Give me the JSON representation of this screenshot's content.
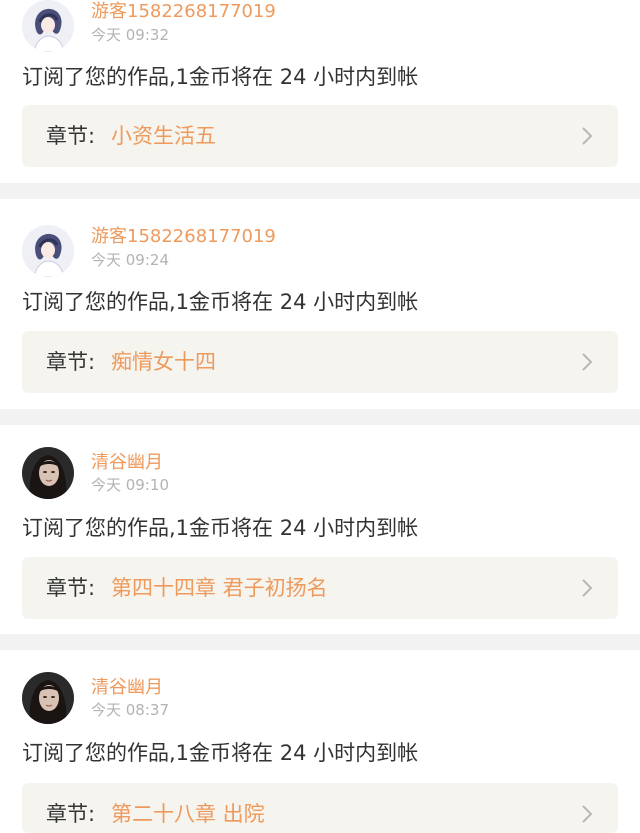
{
  "feed": {
    "items": [
      {
        "avatar_icon": "girl-illustration-avatar-icon",
        "username": "游客1582268177019",
        "time": "今天 09:32",
        "message": "订阅了您的作品,1金币将在 24 小时内到帐",
        "chapter_label": "章节:",
        "chapter_title": "小资生活五"
      },
      {
        "avatar_icon": "girl-illustration-avatar-icon",
        "username": "游客1582268177019",
        "time": "今天 09:24",
        "message": "订阅了您的作品,1金币将在 24 小时内到帐",
        "chapter_label": "章节:",
        "chapter_title": "痴情女十四"
      },
      {
        "avatar_icon": "woman-photo-avatar-icon",
        "username": "清谷幽月",
        "time": "今天 09:10",
        "message": "订阅了您的作品,1金币将在 24 小时内到帐",
        "chapter_label": "章节:",
        "chapter_title": "第四十四章 君子初扬名"
      },
      {
        "avatar_icon": "woman-photo-avatar-icon",
        "username": "清谷幽月",
        "time": "今天 08:37",
        "message": "订阅了您的作品,1金币将在 24 小时内到帐",
        "chapter_label": "章节:",
        "chapter_title": "第二十八章 出院"
      }
    ]
  },
  "colors": {
    "accent": "#ee9a5c",
    "text": "#333333",
    "muted": "#b3b3b3",
    "chapter_bg": "#f5f4ef",
    "divider": "#f2f2f2"
  },
  "icons": {
    "chevron": "chevron-right-icon"
  }
}
